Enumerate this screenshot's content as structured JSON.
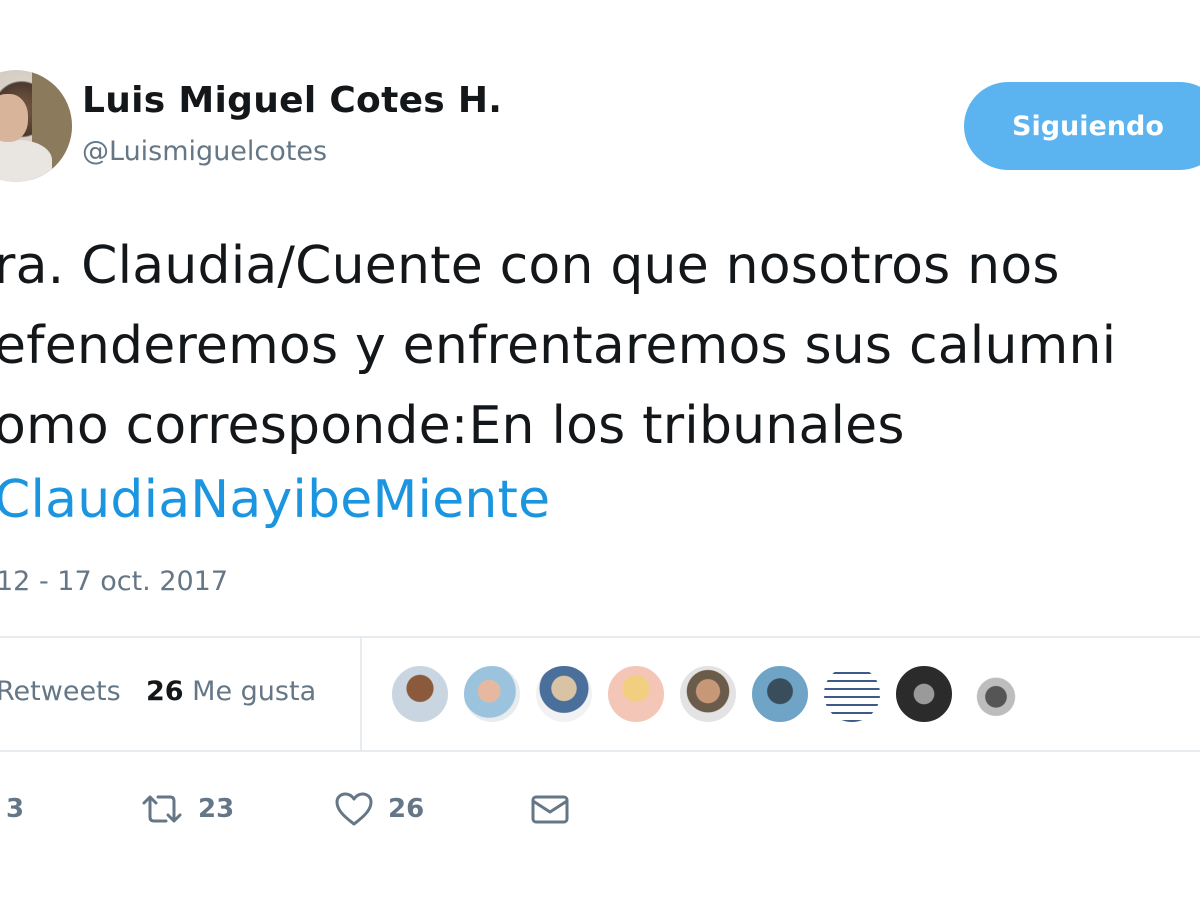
{
  "user": {
    "name": "Luis Miguel Cotes H.",
    "handle": "@Luismiguelcotes"
  },
  "follow_button": {
    "label": "Siguiendo",
    "color": "#5bb4f0"
  },
  "tweet": {
    "lines": [
      "ra. Claudia/Cuente con que nosotros nos",
      "efenderemos y enfrentaremos sus calumni",
      "omo corresponde:En los tribunales"
    ],
    "hashtag": "ClaudiaNayibeMiente",
    "hashtag_color": "#1b95e0",
    "timestamp": "12 - 17 oct. 2017"
  },
  "stats": {
    "retweets_label": "Retweets",
    "likes_count": "26",
    "likes_label": "Me gusta",
    "liker_avatars": 9
  },
  "actions": {
    "reply": {
      "icon": "reply-icon",
      "count": "3"
    },
    "retweet": {
      "icon": "retweet-icon",
      "count": "23"
    },
    "like": {
      "icon": "heart-icon",
      "count": "26"
    },
    "dm": {
      "icon": "envelope-icon"
    }
  }
}
